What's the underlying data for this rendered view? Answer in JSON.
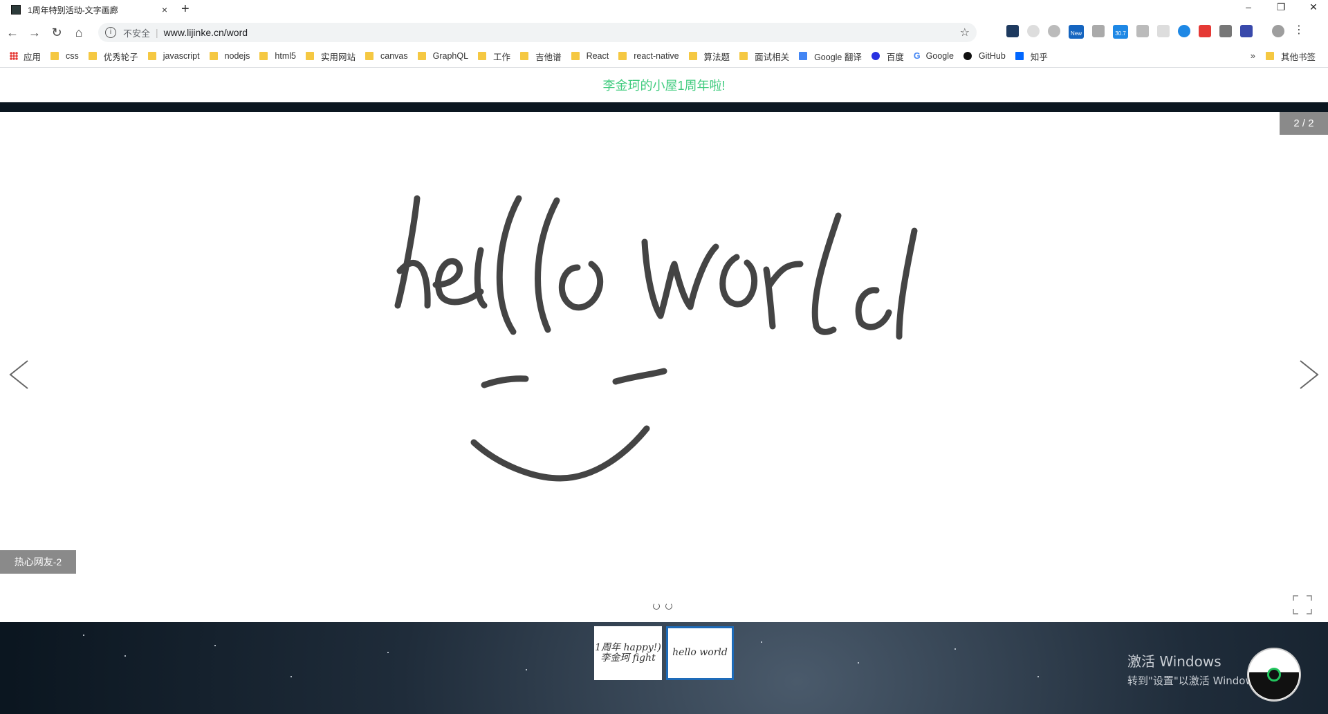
{
  "browser": {
    "tab_title": "1周年特别活动-文字画廊",
    "tab_close": "×",
    "new_tab": "+",
    "win_minimize": "–",
    "win_restore": "❐",
    "win_close": "✕",
    "insecure_label": "不安全",
    "url": "www.lijinke.cn/word",
    "ext_badges": {
      "new": "New",
      "count": "30.7"
    }
  },
  "bookmarks": {
    "apps": "应用",
    "items": [
      "css",
      "优秀轮子",
      "javascript",
      "nodejs",
      "html5",
      "实用网站",
      "canvas",
      "GraphQL",
      "工作",
      "吉他谱",
      "React",
      "react-native",
      "算法题",
      "面试相关"
    ],
    "google_translate": "Google 翻译",
    "baidu": "百度",
    "google": "Google",
    "github": "GitHub",
    "zhihu": "知乎",
    "more": "»",
    "other": "其他书签"
  },
  "page": {
    "header_title": "李金珂的小屋1周年啦!",
    "counter": "2 / 2",
    "caption": "热心网友-2",
    "drawing_text": "hello world"
  },
  "thumbnails": [
    {
      "label": "1周年 happy!) 李金珂 fight"
    },
    {
      "label": "hello world"
    }
  ],
  "watermark": {
    "line1": "激活 Windows",
    "line2": "转到\"设置\"以激活 Windows。"
  },
  "colors": {
    "header_green": "#3ecb7d",
    "active_thumb_border": "#1e6bb8",
    "overlay_gray": "#8a8a8a"
  }
}
